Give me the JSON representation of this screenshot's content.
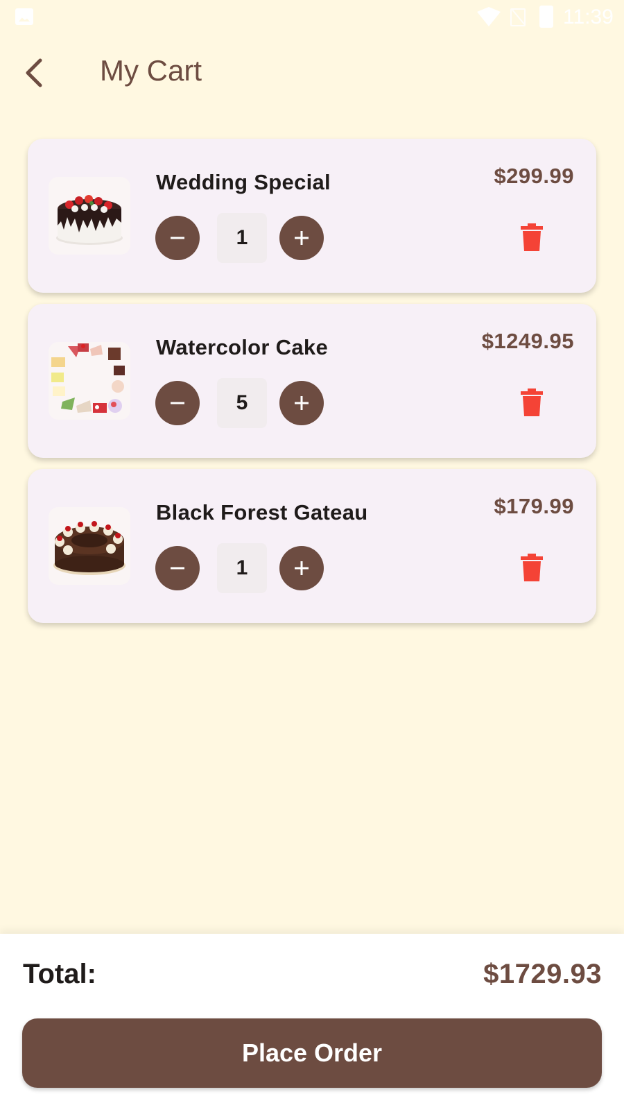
{
  "status_bar": {
    "time": "11:39"
  },
  "header": {
    "title": "My Cart",
    "back_icon": "chevron-left-icon"
  },
  "cart": {
    "items": [
      {
        "name": "Wedding Special",
        "quantity": "1",
        "price": "$299.99",
        "image": "wedding-cake-image"
      },
      {
        "name": "Watercolor Cake",
        "quantity": "5",
        "price": "$1249.95",
        "image": "cake-slices-image"
      },
      {
        "name": "Black Forest Gateau",
        "quantity": "1",
        "price": "$179.99",
        "image": "black-forest-cake-image"
      }
    ]
  },
  "summary": {
    "total_label": "Total:",
    "total_value": "$1729.93"
  },
  "actions": {
    "place_order_label": "Place Order"
  },
  "colors": {
    "background": "#FFF8E1",
    "primary": "#6D4C41",
    "card": "#F7F0F7",
    "delete": "#F44336"
  }
}
